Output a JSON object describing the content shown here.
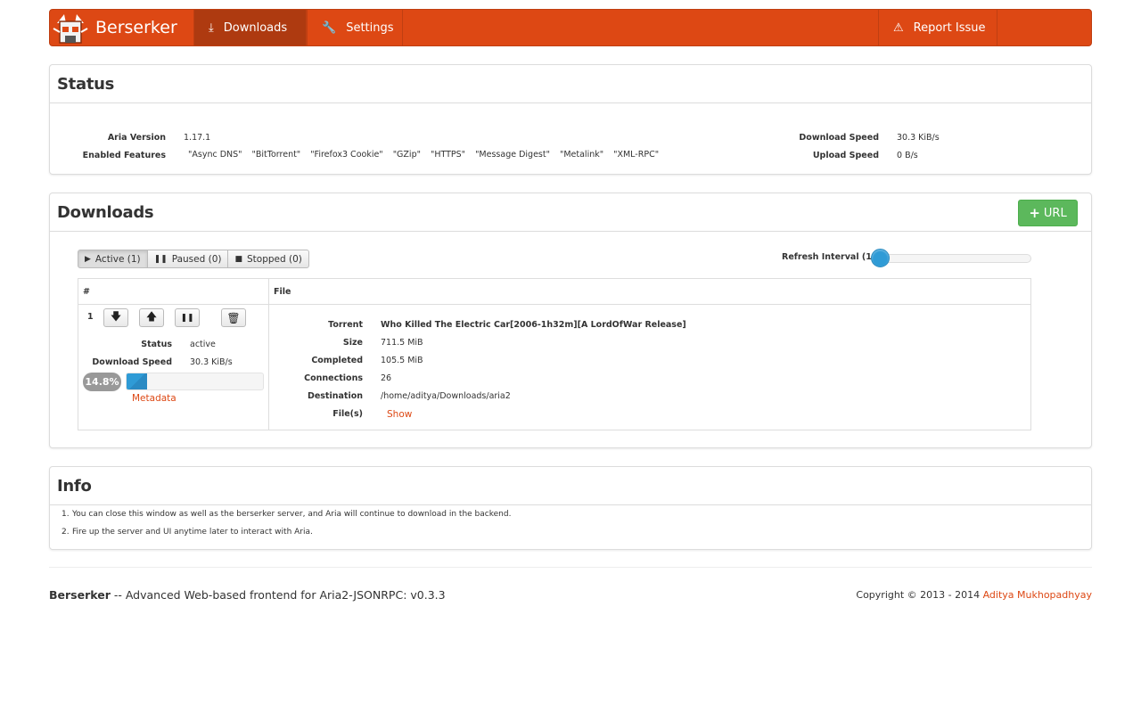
{
  "navbar": {
    "brand": "Berserker",
    "downloads": "Downloads",
    "settings": "Settings",
    "report": "Report Issue",
    "accent": "#dd4814"
  },
  "status": {
    "title": "Status",
    "aria_version_label": "Aria Version",
    "aria_version": "1.17.1",
    "features_label": "Enabled Features",
    "features": [
      "\"Async DNS\"",
      "\"BitTorrent\"",
      "\"Firefox3 Cookie\"",
      "\"GZip\"",
      "\"HTTPS\"",
      "\"Message Digest\"",
      "\"Metalink\"",
      "\"XML-RPC\""
    ],
    "download_speed_label": "Download Speed",
    "download_speed": "30.3 KiB/s",
    "upload_speed_label": "Upload Speed",
    "upload_speed": "0 B/s"
  },
  "downloads": {
    "title": "Downloads",
    "url_button": "URL",
    "filters": {
      "active": "Active (1)",
      "paused": "Paused (0)",
      "stopped": "Stopped (0)"
    },
    "refresh_label": "Refresh Interval (1s)",
    "refresh_interval_s": 1,
    "table": {
      "col_num": "#",
      "col_file": "File"
    },
    "item": {
      "index": "1",
      "status_label": "Status",
      "status": "active",
      "speed_label": "Download Speed",
      "speed": "30.3 KiB/s",
      "progress_text": "14.8%",
      "progress_fraction": 0.148,
      "metadata_link": "Metadata",
      "torrent_label": "Torrent",
      "torrent": "Who Killed The Electric Car[2006-1h32m][A LordOfWar Release]",
      "size_label": "Size",
      "size": "711.5 MiB",
      "completed_label": "Completed",
      "completed": "105.5 MiB",
      "connections_label": "Connections",
      "connections": "26",
      "destination_label": "Destination",
      "destination": "/home/aditya/Downloads/aria2",
      "files_label": "File(s)",
      "files_link": "Show"
    }
  },
  "info": {
    "title": "Info",
    "items": [
      "You can close this window as well as the berserker server, and Aria will continue to download in the backend.",
      "Fire up the server and UI anytime later to interact with Aria."
    ]
  },
  "footer": {
    "brand": "Berserker",
    "tagline": " -- Advanced Web-based frontend for Aria2-JSONRPC: v0.3.3",
    "copyright": "Copyright © 2013 - 2014 ",
    "author": "Aditya Mukhopadhyay"
  }
}
